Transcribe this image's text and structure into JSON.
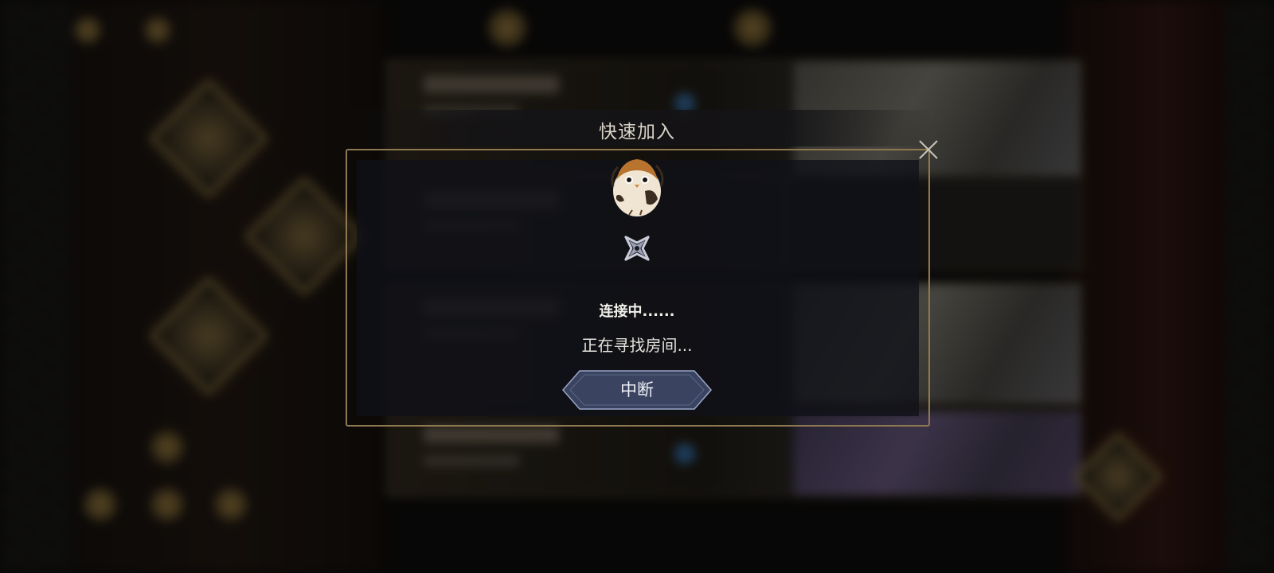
{
  "dialog": {
    "title": "快速加入",
    "status_connecting": "连接中......",
    "status_searching": "正在寻找房间...",
    "abort_label": "中断",
    "close_icon": "close-icon",
    "mascot_icon": "owl-mascot-icon",
    "loading_icon": "shuriken-spinner-icon"
  },
  "colors": {
    "frame_gold": "#8e7850",
    "panel_bg": "#101118",
    "button_blue": "#3a4460",
    "text": "#f2f0ea"
  }
}
